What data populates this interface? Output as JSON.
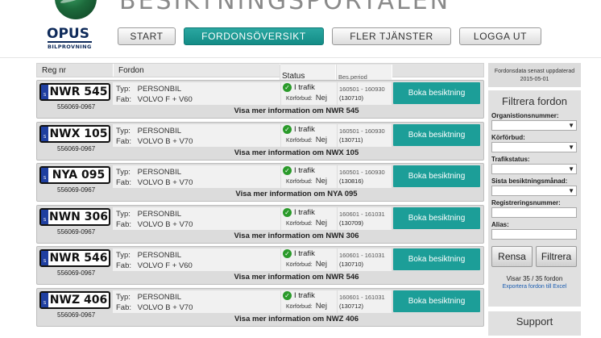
{
  "header": {
    "logo_text": "OPUS",
    "logo_sub": "BILPROVNING",
    "portal_title": "BESIKTNINGSPORTALEN"
  },
  "nav": {
    "start": "START",
    "fordon": "FORDONSÖVERSIKT",
    "fler": "FLER TJÄNSTER",
    "logga": "LOGGA UT"
  },
  "table": {
    "headers": {
      "reg": "Reg nr",
      "fordon": "Fordon",
      "status": "Status",
      "period": "Bes.period"
    },
    "typ_label": "Typ:",
    "fab_label": "Fab:",
    "status_text": "I trafik",
    "korforbud_label": "Körförbud:",
    "korforbud_value": "Nej",
    "boka_label": "Boka besiktning",
    "plate_country": "S",
    "rows": [
      {
        "reg": "NWR 545",
        "org": "556069-0967",
        "typ": "PERSONBIL",
        "fab": "VOLVO F + V60",
        "period": "160501 - 160930",
        "sub": "(130710)",
        "visa": "Visa mer information om NWR 545"
      },
      {
        "reg": "NWX 105",
        "org": "556069-0967",
        "typ": "PERSONBIL",
        "fab": "VOLVO B + V70",
        "period": "160501 - 160930",
        "sub": "(130711)",
        "visa": "Visa mer information om NWX 105"
      },
      {
        "reg": "NYA 095",
        "org": "556069-0967",
        "typ": "PERSONBIL",
        "fab": "VOLVO B + V70",
        "period": "160501 - 160930",
        "sub": "(130816)",
        "visa": "Visa mer information om NYA 095"
      },
      {
        "reg": "NWN 306",
        "org": "556069-0967",
        "typ": "PERSONBIL",
        "fab": "VOLVO B + V70",
        "period": "160601 - 161031",
        "sub": "(130709)",
        "visa": "Visa mer information om NWN 306"
      },
      {
        "reg": "NWR 546",
        "org": "556069-0967",
        "typ": "PERSONBIL",
        "fab": "VOLVO F + V60",
        "period": "160601 - 161031",
        "sub": "(130710)",
        "visa": "Visa mer information om NWR 546"
      },
      {
        "reg": "NWZ 406",
        "org": "556069-0967",
        "typ": "PERSONBIL",
        "fab": "VOLVO B + V70",
        "period": "160601 - 161031",
        "sub": "(130712)",
        "visa": "Visa mer information om NWZ 406"
      }
    ]
  },
  "sidebar": {
    "updated_line1": "Fordonsdata senast uppdaterad",
    "updated_line2": "2015-05-01",
    "filter_title": "Filtrera fordon",
    "labels": {
      "org": "Organistionsnummer:",
      "korforbud": "Körförbud:",
      "trafik": "Trafikstatus:",
      "manad": "Sista besiktningsmånad:",
      "regnr": "Registreringsnummer:",
      "alias": "Alias:"
    },
    "rensa": "Rensa",
    "filtrera": "Filtrera",
    "count": "Visar 35 / 35 fordon",
    "export": "Exportera fordon till Excel",
    "support": "Support"
  }
}
